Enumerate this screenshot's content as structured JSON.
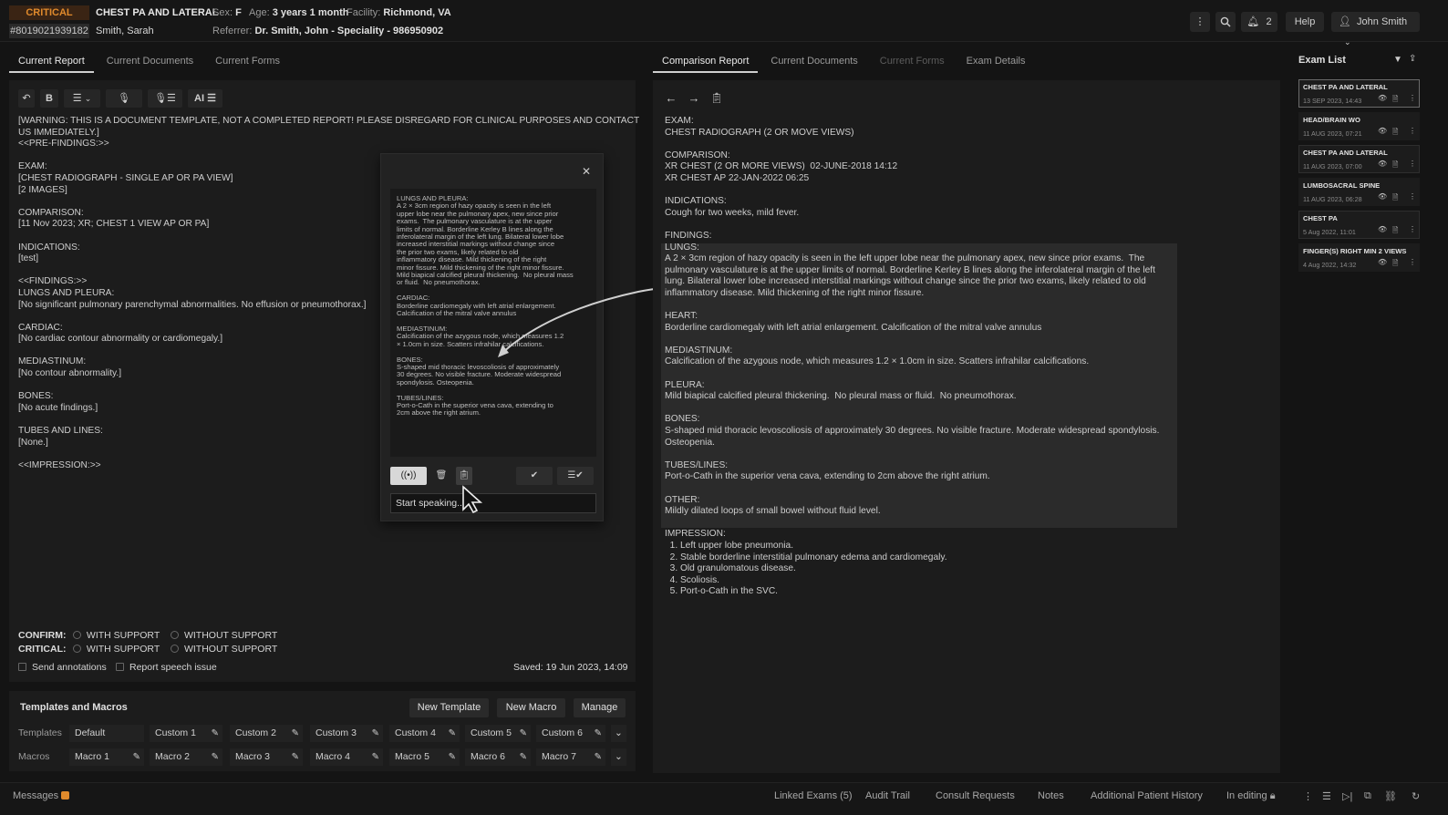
{
  "header": {
    "critical": "CRITICAL",
    "accession": "#8019021939182",
    "exam_title": "CHEST PA AND LATERAL",
    "patient": "Smith, Sarah",
    "sex_label": "Sex:",
    "sex": "F",
    "age_label": "Age:",
    "age": "3 years 1 month",
    "facility_label": "Facility:",
    "facility": "Richmond, VA",
    "referrer_label": "Referrer:",
    "referrer": "Dr. Smith, John - Speciality - 986950902",
    "notif_count": "2",
    "help": "Help",
    "user": "John Smith"
  },
  "left_tabs": [
    "Current Report",
    "Current Documents",
    "Current Forms"
  ],
  "right_tabs": [
    "Comparison Report",
    "Current Documents",
    "Current Forms",
    "Exam Details"
  ],
  "exam_list_title": "Exam List",
  "toolbar": {
    "bold": "B",
    "ai": "AI"
  },
  "report_text": "[WARNING: THIS IS A DOCUMENT TEMPLATE, NOT A COMPLETED REPORT! PLEASE DISREGARD FOR CLINICAL PURPOSES AND CONTACT\nUS IMMEDIATELY.]\n<<PRE-FINDINGS:>>\n\nEXAM:\n[CHEST RADIOGRAPH - SINGLE AP OR PA VIEW]\n[2 IMAGES]\n\nCOMPARISON:\n[11 Nov 2023; XR; CHEST 1 VIEW AP OR PA]\n\nINDICATIONS:\n[test]\n\n<<FINDINGS:>>\nLUNGS AND PLEURA:\n[No significant pulmonary parenchymal abnormalities. No effusion or pneumothorax.]\n\nCARDIAC:\n[No cardiac contour abnormality or cardiomegaly.]\n\nMEDIASTINUM:\n[No contour abnormality.]\n\nBONES:\n[No acute findings.]\n\nTUBES AND LINES:\n[None.]\n\n<<IMPRESSION:>>",
  "popup": {
    "text": "LUNGS AND PLEURA:\nA 2 × 3cm region of hazy opacity is seen in the left\nupper lobe near the pulmonary apex, new since prior\nexams.  The pulmonary vasculature is at the upper\nlimits of normal. Borderline Kerley B lines along the\ninferolateral margin of the left lung. Bilateral lower lobe\nincreased interstitial markings without change since\nthe prior two exams, likely related to old\ninflammatory disease. Mild thickening of the right\nminor fissure. Mild thickening of the right minor fissure.\nMild biapical calcified pleural thickening.  No pleural mass\nor fluid.  No pneumothorax.\n\nCARDIAC:\nBorderline cardiomegaly with left atrial enlargement.\nCalcification of the mitral valve annulus\n\nMEDIASTINUM:\nCalcification of the azygous node, which measures 1.2\n× 1.0cm in size. Scatters infrahilar calcifications.\n\nBONES:\nS-shaped mid thoracic levoscoliosis of approximately\n30 degrees. No visible fracture. Moderate widespread\nspondylosis. Osteopenia.\n\nTUBES/LINES:\nPort-o-Cath in the superior vena cava, extending to\n2cm above the right atrium.",
    "speech_placeholder": "Start speaking..."
  },
  "confirm": {
    "confirm_label": "CONFIRM:",
    "critical_label": "CRITICAL:",
    "with": "WITH SUPPORT",
    "without": "WITHOUT SUPPORT"
  },
  "checks": {
    "send": "Send annotations",
    "speech": "Report speech issue"
  },
  "saved": "Saved: 19 Jun 2023, 14:09",
  "templates": {
    "title": "Templates and Macros",
    "new_template": "New Template",
    "new_macro": "New Macro",
    "manage": "Manage",
    "templates_label": "Templates",
    "macros_label": "Macros",
    "templates": [
      "Default",
      "Custom 1",
      "Custom 2",
      "Custom 3",
      "Custom 4",
      "Custom 5",
      "Custom 6"
    ],
    "macros": [
      "Macro 1",
      "Macro 2",
      "Macro 3",
      "Macro 4",
      "Macro 5",
      "Macro 6",
      "Macro 7"
    ]
  },
  "comparison_text": "EXAM:\nCHEST RADIOGRAPH (2 OR MOVE VIEWS)\n\nCOMPARISON:\nXR CHEST (2 OR MORE VIEWS)  02-JUNE-2018 14:12\nXR CHEST AP 22-JAN-2022 06:25\n\nINDICATIONS:\nCough for two weeks, mild fever.\n\nFINDINGS:\nLUNGS:\nA 2 × 3cm region of hazy opacity is seen in the left upper lobe near the pulmonary apex, new since prior exams.  The\npulmonary vasculature is at the upper limits of normal. Borderline Kerley B lines along the inferolateral margin of the left\nlung. Bilateral lower lobe increased interstitial markings without change since the prior two exams, likely related to old\ninflammatory disease. Mild thickening of the right minor fissure.\n\nHEART:\nBorderline cardiomegaly with left atrial enlargement. Calcification of the mitral valve annulus\n\nMEDIASTINUM:\nCalcification of the azygous node, which measures 1.2 × 1.0cm in size. Scatters infrahilar calcifications.\n\nPLEURA:\nMild biapical calcified pleural thickening.  No pleural mass or fluid.  No pneumothorax.\n\nBONES:\nS-shaped mid thoracic levoscoliosis of approximately 30 degrees. No visible fracture. Moderate widespread spondylosis.\nOsteopenia.\n\nTUBES/LINES:\nPort-o-Cath in the superior vena cava, extending to 2cm above the right atrium.\n\nOTHER:\nMildly dilated loops of small bowel without fluid level.\n\nIMPRESSION:\n  1. Left upper lobe pneumonia.\n  2. Stable borderline interstitial pulmonary edema and cardiomegaly.\n  3. Old granulomatous disease.\n  4. Scoliosis.\n  5. Port-o-Cath in the SVC.",
  "exam_list": [
    {
      "name": "CHEST PA AND LATERAL",
      "date": "13 SEP 2023, 14:43"
    },
    {
      "name": "HEAD/BRAIN WO",
      "date": "11 AUG 2023, 07:21"
    },
    {
      "name": "CHEST PA AND LATERAL",
      "date": "11 AUG 2023, 07:00"
    },
    {
      "name": "LUMBOSACRAL SPINE",
      "date": "11 AUG 2023, 06:28"
    },
    {
      "name": "CHEST PA",
      "date": "5 Aug 2022, 11:01"
    },
    {
      "name": "FINGER(S) RIGHT MIN 2 VIEWS",
      "date": "4 Aug 2022, 14:32"
    }
  ],
  "footer": {
    "messages": "Messages",
    "links": [
      "Linked Exams (5)",
      "Audit Trail",
      "Consult Requests",
      "Notes",
      "Additional Patient History",
      "In editing"
    ]
  },
  "colors": {
    "accent": "#e08a2c",
    "background": "#141414",
    "panel": "#1c1c1c"
  }
}
